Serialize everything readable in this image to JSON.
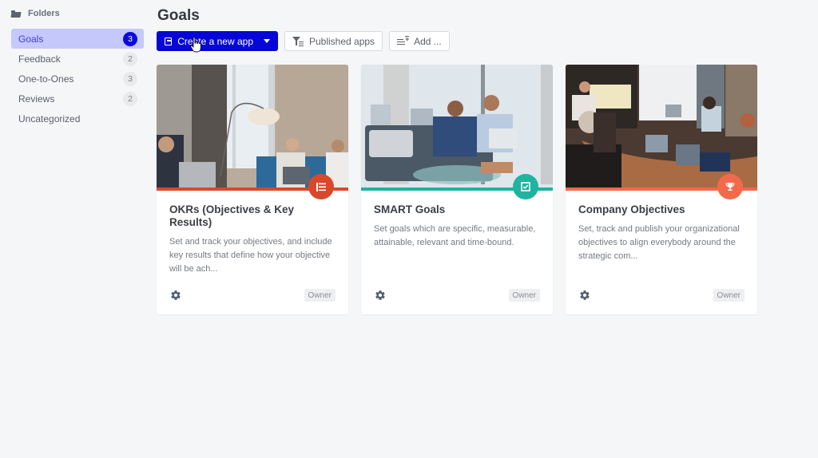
{
  "sidebar": {
    "heading": "Folders",
    "items": [
      {
        "label": "Goals",
        "count": "3",
        "active": true
      },
      {
        "label": "Feedback",
        "count": "2"
      },
      {
        "label": "One-to-Ones",
        "count": "3"
      },
      {
        "label": "Reviews",
        "count": "2"
      },
      {
        "label": "Uncategorized",
        "count": null
      }
    ]
  },
  "header": {
    "title": "Goals"
  },
  "toolbar": {
    "create_label": "Create a new app",
    "published_label": "Published apps",
    "add_label": "Add ..."
  },
  "colors": {
    "accent": "#0606d8",
    "active_folder_bg": "#c5c8fb",
    "okr": "#d9482b",
    "smart": "#1fb3a0",
    "company": "#f26a4b"
  },
  "cards": [
    {
      "title": "OKRs (Objectives & Key Results)",
      "description": "Set and track your objectives, and include key results that define how your objective will be ach...",
      "icon": "list-icon",
      "badge": "Owner"
    },
    {
      "title": "SMART Goals",
      "description": "Set goals which are specific, measurable, attainable, relevant and time-bound.",
      "icon": "checkbox-icon",
      "badge": "Owner"
    },
    {
      "title": "Company Objectives",
      "description": "Set, track and publish your organizational objectives to align everybody around the strategic com...",
      "icon": "trophy-icon",
      "badge": "Owner"
    }
  ]
}
